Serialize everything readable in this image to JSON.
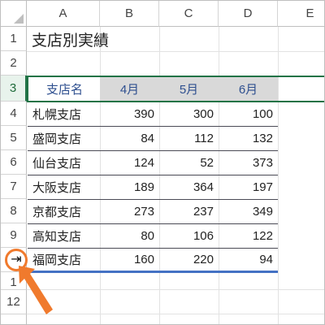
{
  "columns": [
    "A",
    "B",
    "C",
    "D",
    "E"
  ],
  "rows": [
    "1",
    "2",
    "3",
    "4",
    "5",
    "6",
    "7",
    "8",
    "9",
    "1",
    "12"
  ],
  "title": "支店別実績",
  "table_header": [
    "支店名",
    "4月",
    "5月",
    "6月"
  ],
  "table_rows": [
    {
      "name": "札幌支店",
      "v": [
        "390",
        "300",
        "100"
      ]
    },
    {
      "name": "盛岡支店",
      "v": [
        "84",
        "112",
        "132"
      ]
    },
    {
      "name": "仙台支店",
      "v": [
        "124",
        "52",
        "373"
      ]
    },
    {
      "name": "大阪支店",
      "v": [
        "189",
        "364",
        "197"
      ]
    },
    {
      "name": "京都支店",
      "v": [
        "273",
        "237",
        "349"
      ]
    },
    {
      "name": "高知支店",
      "v": [
        "80",
        "106",
        "122"
      ]
    },
    {
      "name": "福岡支店",
      "v": [
        "160",
        "220",
        "94"
      ]
    }
  ],
  "colors": {
    "accent": "#217346",
    "arrow": "#f07a2d",
    "line": "#4472c4",
    "header_fill": "#d9d9d9"
  },
  "row_insert_icon": "row-insert-icon"
}
